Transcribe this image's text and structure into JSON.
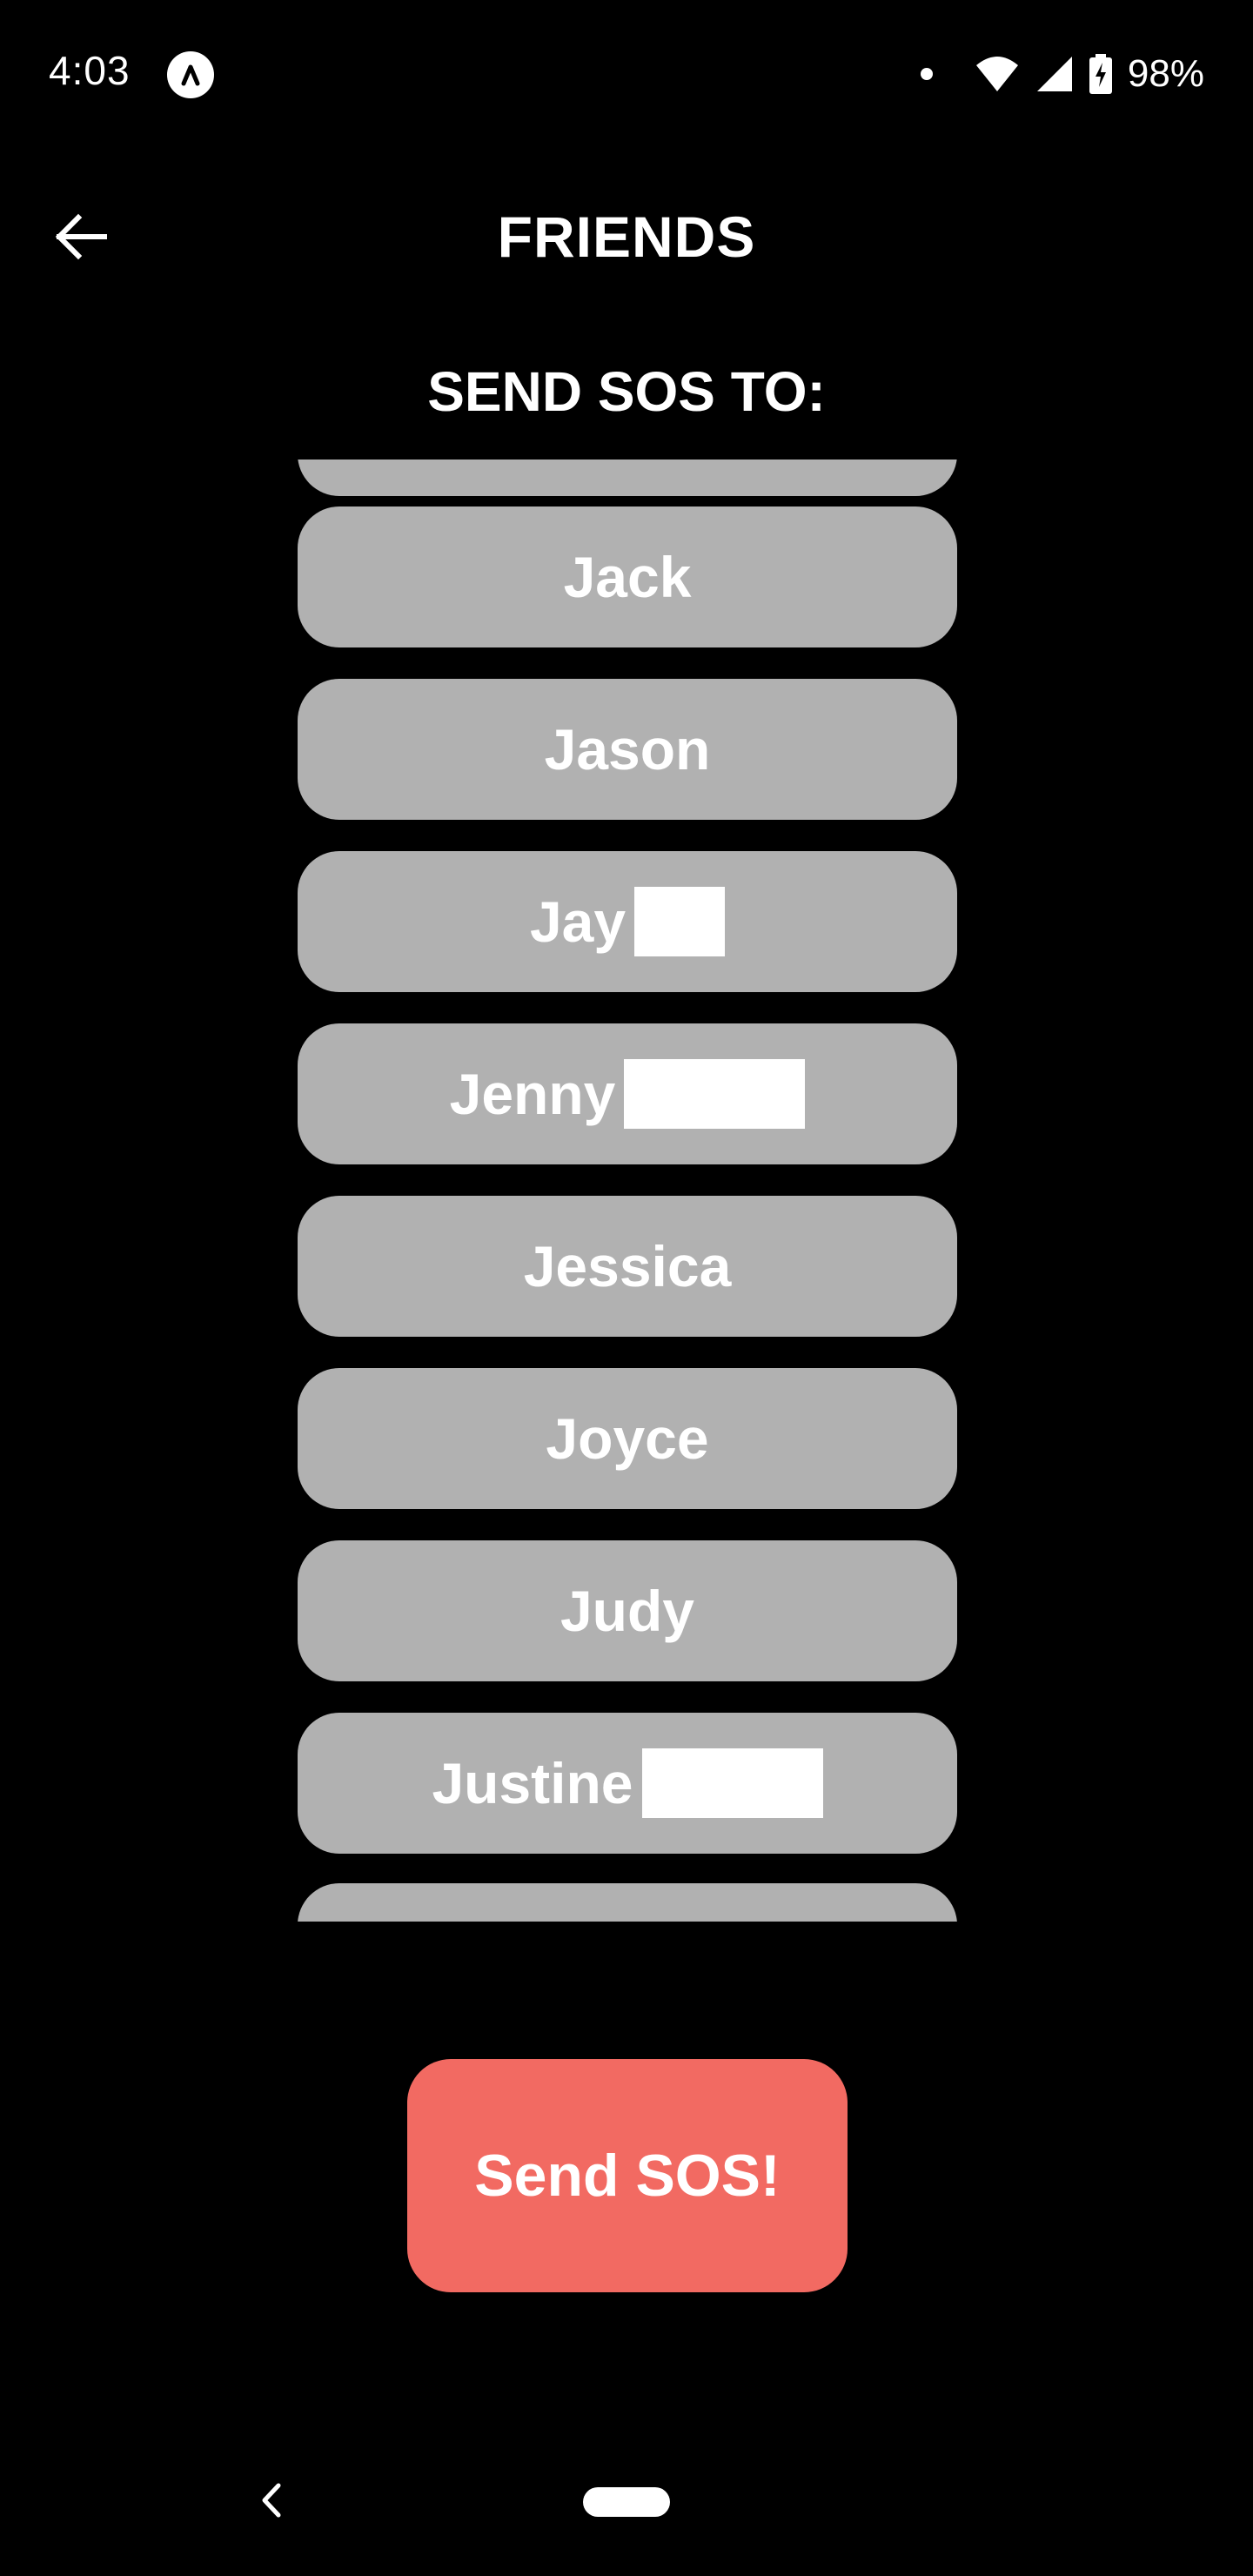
{
  "status_bar": {
    "time": "4:03",
    "battery_percent": "98%",
    "icons": [
      "app-badge-icon",
      "notification-dot-icon",
      "wifi-icon",
      "cell-signal-icon",
      "battery-charging-icon"
    ]
  },
  "header": {
    "title": "FRIENDS",
    "back_icon": "arrow-left-icon"
  },
  "section": {
    "heading": "SEND SOS TO:"
  },
  "friends": [
    {
      "label": ""
    },
    {
      "label": "Jack"
    },
    {
      "label": "Jason"
    },
    {
      "label": "Jay"
    },
    {
      "label": "Jenny"
    },
    {
      "label": "Jessica"
    },
    {
      "label": "Joyce"
    },
    {
      "label": "Judy"
    },
    {
      "label": "Justine"
    },
    {
      "label": ""
    }
  ],
  "sos_button": {
    "label": "Send SOS!",
    "color": "#f26a62"
  },
  "colors": {
    "background": "#000000",
    "friend_button": "#b1b1b1",
    "text": "#ffffff"
  },
  "nav_bar": {
    "icons": [
      "nav-back-icon",
      "nav-home-pill"
    ]
  }
}
